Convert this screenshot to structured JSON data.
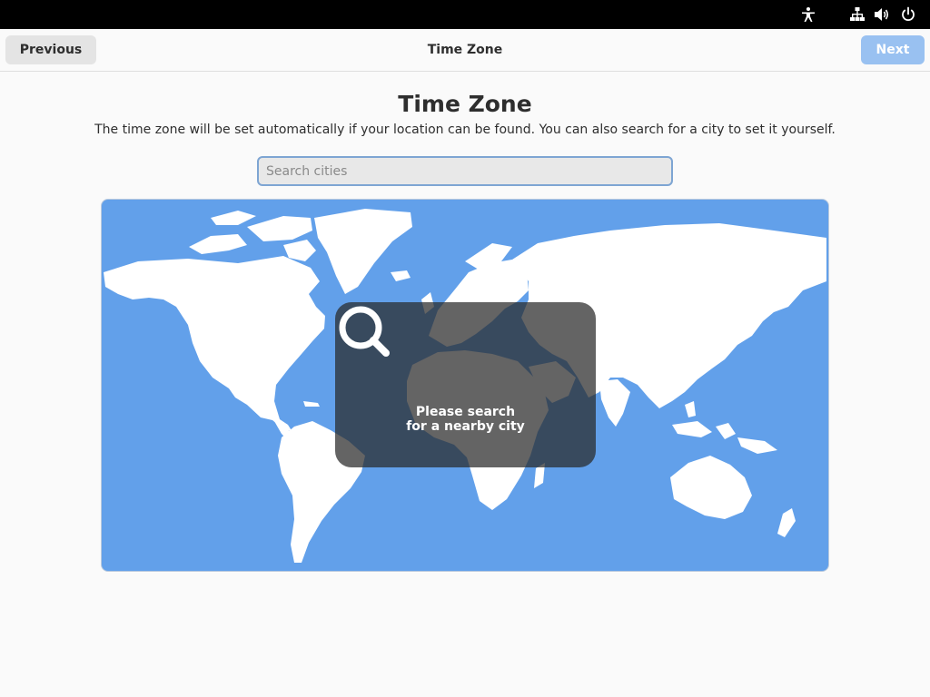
{
  "top_bar": {
    "icons": [
      "accessibility-icon",
      "network-icon",
      "volume-icon",
      "power-icon"
    ]
  },
  "header": {
    "previous_label": "Previous",
    "title": "Time Zone",
    "next_label": "Next"
  },
  "page": {
    "title": "Time Zone",
    "description": "The time zone will be set automatically if your location can be found. You can also search for a city to set it yourself."
  },
  "search": {
    "placeholder": "Search cities",
    "value": ""
  },
  "map": {
    "overlay_icon": "search-icon",
    "overlay_line1": "Please search",
    "overlay_line2": "for a nearby city"
  },
  "colors": {
    "ocean": "#62a0ea",
    "land": "#ffffff",
    "topbar": "#000000",
    "next_button": "#99c1f1",
    "previous_button": "#e4e4e4",
    "overlay": "#282828"
  }
}
